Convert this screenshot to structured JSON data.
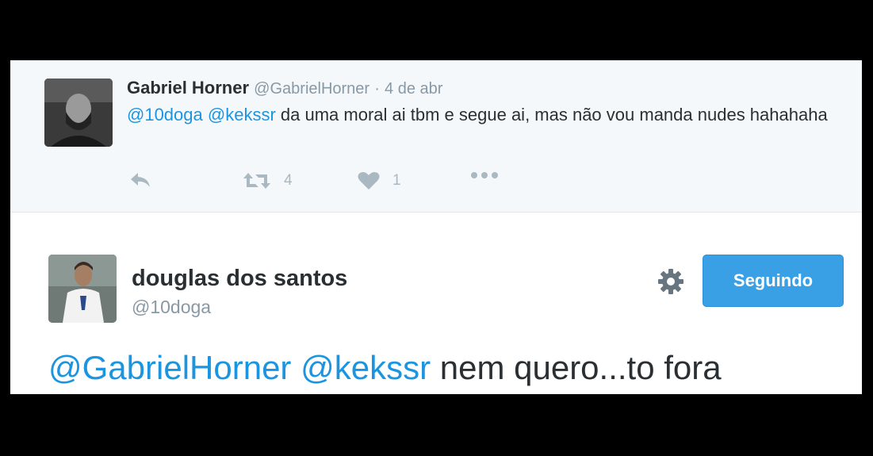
{
  "tweet1": {
    "name": "Gabriel Horner",
    "handle": "@GabrielHorner",
    "separator": "·",
    "date": "4 de abr",
    "mention1": "@10doga",
    "mention2": "@kekssr",
    "text": "da uma moral ai tbm e segue ai, mas não vou manda nudes hahahaha",
    "retweet_count": "4",
    "like_count": "1",
    "icons": [
      "reply-icon",
      "retweet-icon",
      "heart-icon",
      "more-icon"
    ]
  },
  "tweet2": {
    "name": "douglas dos santos",
    "handle": "@10doga",
    "follow_label": "Seguindo",
    "mention1": "@GabrielHorner",
    "mention2": "@kekssr",
    "text": "nem quero...to fora",
    "icons": [
      "gear-icon"
    ]
  },
  "colors": {
    "mention": "#1b95e0",
    "button": "#3aa0e6",
    "muted": "#8899a6",
    "action": "#aab8c2",
    "tweet1_background": "#f5f8fa"
  }
}
